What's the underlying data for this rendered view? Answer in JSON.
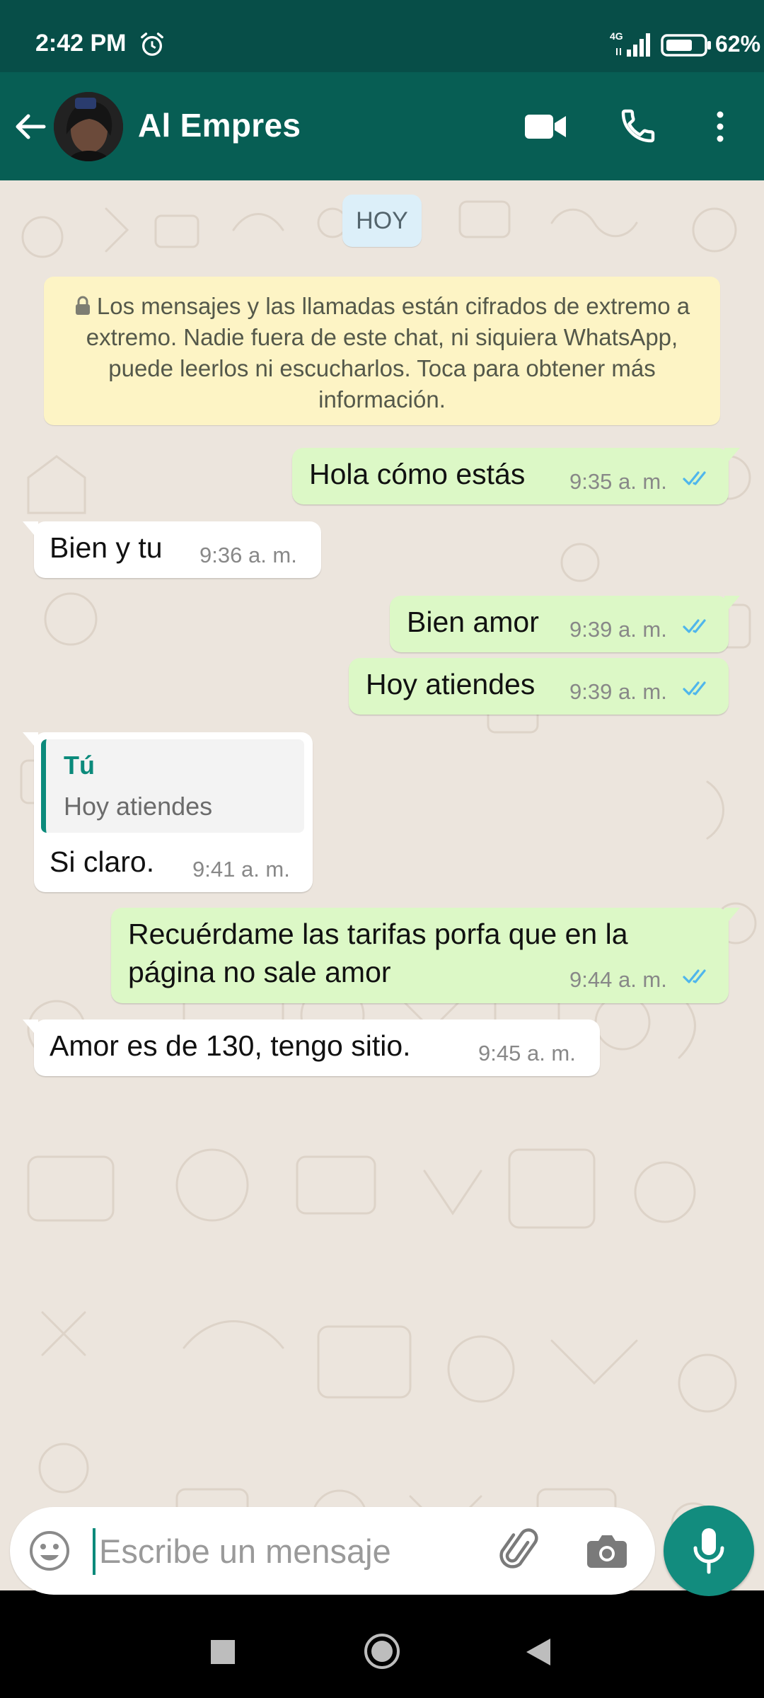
{
  "status_bar": {
    "time": "2:42 PM",
    "network": "4G",
    "battery": "62%"
  },
  "header": {
    "contact_name": "Al Empres"
  },
  "chat": {
    "date_chip": "HOY",
    "encryption_notice": "Los mensajes y las llamadas están cifrados de extremo a extremo. Nadie fuera de este chat, ni siquiera WhatsApp, puede leerlos ni escucharlos. Toca para obtener más información.",
    "messages": [
      {
        "direction": "out",
        "text": "Hola cómo estás",
        "time": "9:35 a. m."
      },
      {
        "direction": "in",
        "text": "Bien y tu",
        "time": "9:36 a. m."
      },
      {
        "direction": "out",
        "text": "Bien amor",
        "time": "9:39 a. m."
      },
      {
        "direction": "out",
        "text": "Hoy atiendes",
        "time": "9:39 a. m."
      },
      {
        "direction": "in",
        "text": "Si claro.",
        "time": "9:41 a. m.",
        "quote": {
          "author": "Tú",
          "text": "Hoy atiendes"
        }
      },
      {
        "direction": "out",
        "text_lines": [
          "Recuérdame las tarifas porfa que en la",
          "página no sale amor"
        ],
        "time": "9:44 a. m."
      },
      {
        "direction": "in",
        "text": "Amor es de 130, tengo sitio.",
        "time": "9:45 a. m."
      }
    ]
  },
  "input": {
    "placeholder": "Escribe un mensaje"
  },
  "colors": {
    "header": "#075e54",
    "outgoing_bubble": "#dcf8c6",
    "incoming_bubble": "#ffffff",
    "accent": "#128c7e",
    "read_ticks": "#4fb6ec"
  },
  "icons": [
    "alarm-icon",
    "signal-icon",
    "battery-icon",
    "back-arrow-icon",
    "video-call-icon",
    "phone-icon",
    "more-options-icon",
    "lock-icon",
    "double-check-icon",
    "emoji-icon",
    "attach-icon",
    "camera-icon",
    "mic-icon"
  ]
}
